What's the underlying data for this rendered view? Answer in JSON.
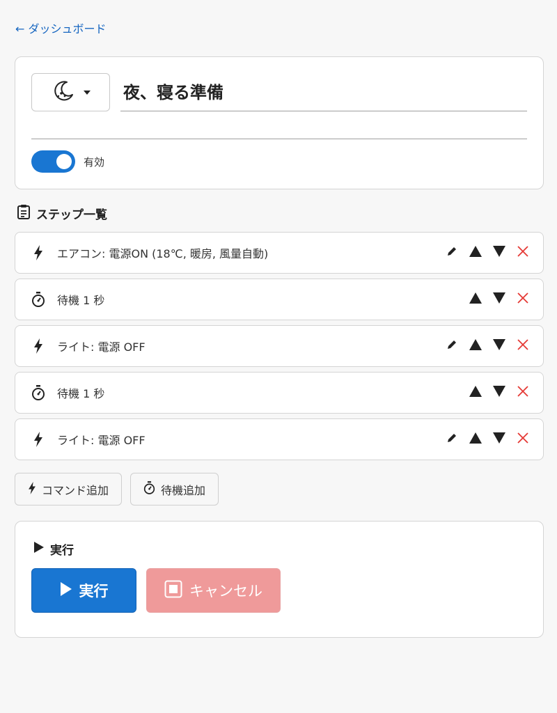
{
  "nav": {
    "back_label": "← ダッシュボード"
  },
  "header": {
    "icon": "moon-icon",
    "title": "夜、寝る準備",
    "description": "",
    "enabled_label": "有効",
    "enabled": true
  },
  "steps_section": {
    "title": "ステップ一覧",
    "items": [
      {
        "type": "command",
        "icon": "bolt-icon",
        "label": "エアコン: 電源ON (18℃, 暖房, 風量自動)",
        "editable": true
      },
      {
        "type": "wait",
        "icon": "stopwatch-icon",
        "label": "待機 1 秒",
        "editable": false
      },
      {
        "type": "command",
        "icon": "bolt-icon",
        "label": "ライト: 電源 OFF",
        "editable": true
      },
      {
        "type": "wait",
        "icon": "stopwatch-icon",
        "label": "待機 1 秒",
        "editable": false
      },
      {
        "type": "command",
        "icon": "bolt-icon",
        "label": "ライト: 電源 OFF",
        "editable": true
      }
    ]
  },
  "add_buttons": {
    "command": "コマンド追加",
    "wait": "待機追加"
  },
  "run_section": {
    "title": "実行",
    "run_label": "実行",
    "cancel_label": "キャンセル"
  },
  "colors": {
    "primary": "#1976d2",
    "cancel": "#ef9a9a",
    "delete": "#e53935"
  }
}
